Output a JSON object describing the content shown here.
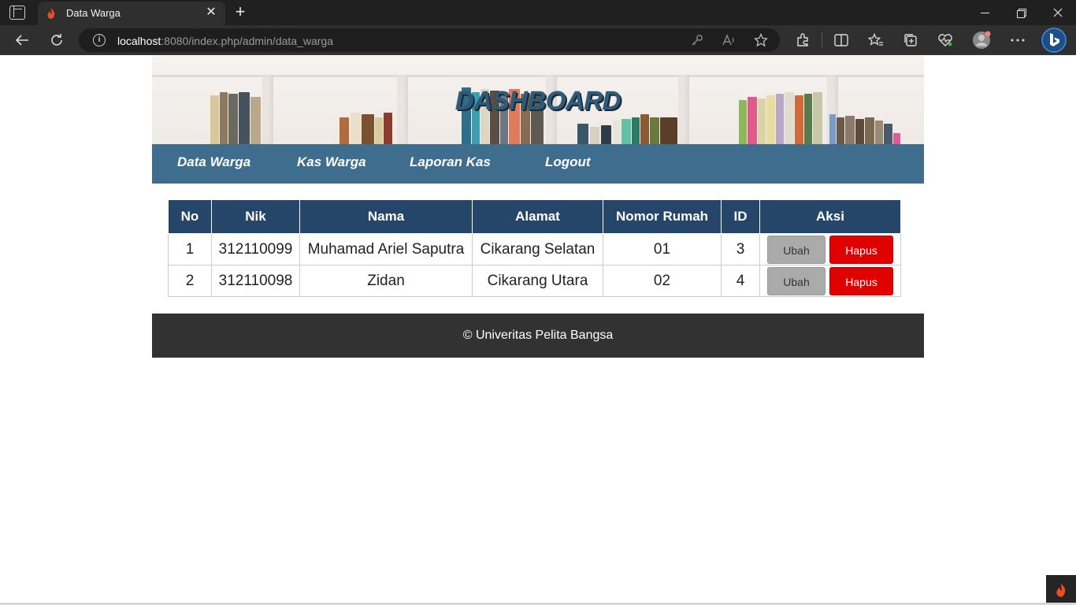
{
  "browser": {
    "tab_title": "Data Warga",
    "url_host": "localhost",
    "url_path": ":8080/index.php/admin/data_warga"
  },
  "banner": {
    "title": "DASHBOARD"
  },
  "nav": {
    "items": [
      {
        "label": "Data Warga"
      },
      {
        "label": "Kas Warga"
      },
      {
        "label": "Laporan Kas"
      },
      {
        "label": "Logout"
      }
    ]
  },
  "table": {
    "headers": [
      "No",
      "Nik",
      "Nama",
      "Alamat",
      "Nomor Rumah",
      "ID",
      "Aksi"
    ],
    "rows": [
      {
        "no": "1",
        "nik": "312110099",
        "nama": "Muhamad Ariel Saputra",
        "alamat": "Cikarang Selatan",
        "nomor_rumah": "01",
        "id": "3"
      },
      {
        "no": "2",
        "nik": "312110098",
        "nama": "Zidan",
        "alamat": "Cikarang Utara",
        "nomor_rumah": "02",
        "id": "4"
      }
    ],
    "edit_label": "Ubah",
    "delete_label": "Hapus"
  },
  "footer": {
    "text": "© Univeritas Pelita Bangsa"
  },
  "colors": {
    "nav_bg": "#3e6d8e",
    "table_header_bg": "#254668",
    "delete_button": "#e10000",
    "edit_button": "#aaaaaa",
    "footer_bg": "#323232"
  }
}
